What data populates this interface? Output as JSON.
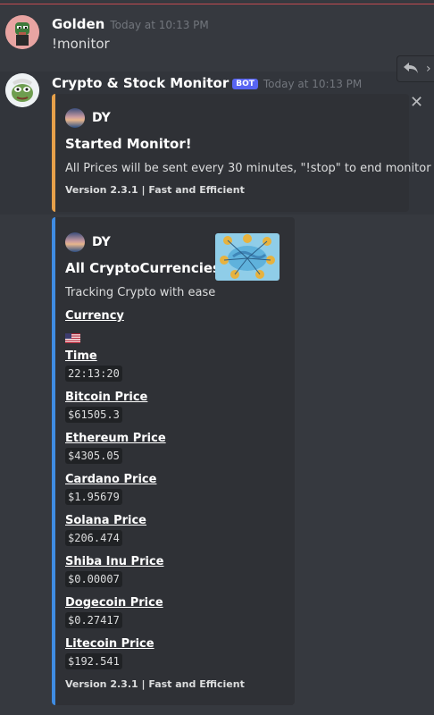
{
  "messages": [
    {
      "author": "Golden",
      "timestamp": "Today at 10:13 PM",
      "content": "!monitor"
    },
    {
      "author": "Crypto & Stock Monitor",
      "bot_tag": "BOT",
      "timestamp": "Today at 10:13 PM",
      "embeds": [
        {
          "color": "#e6a04a",
          "author": "DY",
          "title": "Started Monitor!",
          "description": "All Prices will be sent every 30 minutes, \"!stop\" to end monitor",
          "footer": "Version 2.3.1 | Fast and Efficient"
        },
        {
          "color": "#3f8ce3",
          "author": "DY",
          "title": "All CryptoCurrencies",
          "description": "Tracking Crypto with ease",
          "thumbnail_icon": "crypto-network-thumbnail",
          "fields": [
            {
              "name": "Currency",
              "value": "",
              "icon": "us-flag-icon"
            },
            {
              "name": "Time",
              "value": "22:13:20"
            },
            {
              "name": "Bitcoin Price",
              "value": "$61505.3"
            },
            {
              "name": "Ethereum Price",
              "value": "$4305.05"
            },
            {
              "name": "Cardano Price",
              "value": "$1.95679"
            },
            {
              "name": "Solana Price",
              "value": "$206.474"
            },
            {
              "name": "Shiba Inu Price",
              "value": "$0.00007"
            },
            {
              "name": "Dogecoin Price",
              "value": "$0.27417"
            },
            {
              "name": "Litecoin Price",
              "value": "$192.541"
            }
          ],
          "footer": "Version 2.3.1 | Fast and Efficient"
        }
      ]
    }
  ],
  "icons": {
    "reply": "reply-icon",
    "more": "more-icon",
    "close": "close-icon"
  },
  "colors": {
    "background": "#36393f",
    "embed_background": "#2f3136",
    "bot_tag": "#5865f2"
  }
}
